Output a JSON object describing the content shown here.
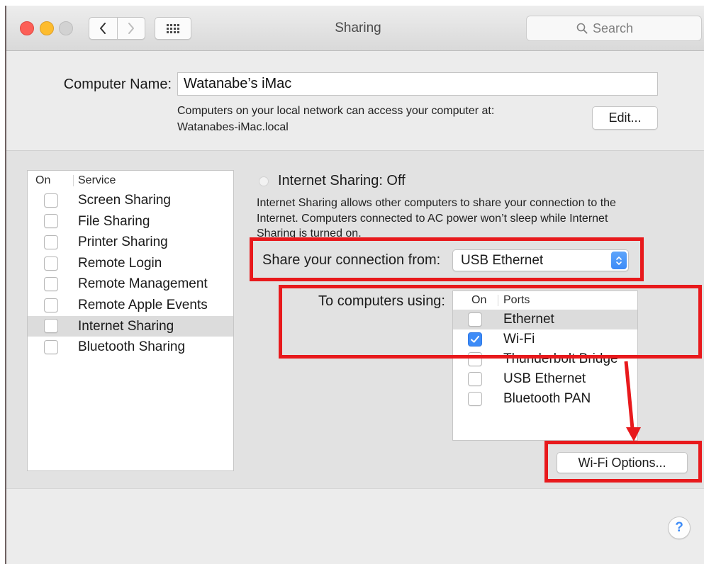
{
  "window": {
    "title": "Sharing",
    "search_placeholder": "Search"
  },
  "icons": {
    "back": "chevron-left-icon",
    "forward": "chevron-right-icon",
    "show_all": "grid-icon",
    "search": "search-icon",
    "popup": "up-down-chevron-icon",
    "check": "checkmark-icon"
  },
  "computer_name": {
    "label": "Computer Name:",
    "value": "Watanabe’s iMac",
    "info_lines": [
      "Computers on your local network can access your computer at:",
      "Watanabes-iMac.local"
    ],
    "edit_label": "Edit..."
  },
  "services": {
    "header": {
      "on": "On",
      "service": "Service"
    },
    "items": [
      {
        "label": "Screen Sharing",
        "checked": false,
        "selected": false
      },
      {
        "label": "File Sharing",
        "checked": false,
        "selected": false
      },
      {
        "label": "Printer Sharing",
        "checked": false,
        "selected": false
      },
      {
        "label": "Remote Login",
        "checked": false,
        "selected": false
      },
      {
        "label": "Remote Management",
        "checked": false,
        "selected": false
      },
      {
        "label": "Remote Apple Events",
        "checked": false,
        "selected": false
      },
      {
        "label": "Internet Sharing",
        "checked": false,
        "selected": true
      },
      {
        "label": "Bluetooth Sharing",
        "checked": false,
        "selected": false
      }
    ]
  },
  "internet_sharing": {
    "status": "Internet Sharing: Off",
    "description_lines": [
      "Internet Sharing allows other computers to share your connection to the",
      "Internet. Computers connected to AC power won’t sleep while Internet",
      "Sharing is turned on."
    ],
    "share_from": {
      "label": "Share your connection from:",
      "value": "USB Ethernet"
    },
    "to_computers": {
      "label": "To computers using:",
      "header": {
        "on": "On",
        "ports": "Ports"
      },
      "ports": [
        {
          "label": "Ethernet",
          "checked": false,
          "selected": true
        },
        {
          "label": "Wi-Fi",
          "checked": true,
          "selected": false
        },
        {
          "label": "Thunderbolt Bridge",
          "checked": false,
          "selected": false
        },
        {
          "label": "USB Ethernet",
          "checked": false,
          "selected": false
        },
        {
          "label": "Bluetooth PAN",
          "checked": false,
          "selected": false
        }
      ]
    },
    "wifi_options_label": "Wi-Fi Options..."
  },
  "help": {
    "label": "?"
  },
  "colors": {
    "accent": "#3d8bf7",
    "annotation": "#e8191c",
    "close": "#fc5f57",
    "minimize": "#fdbc2e",
    "zoom_disabled": "#d2d2d2",
    "selection": "#dcdcdc"
  }
}
